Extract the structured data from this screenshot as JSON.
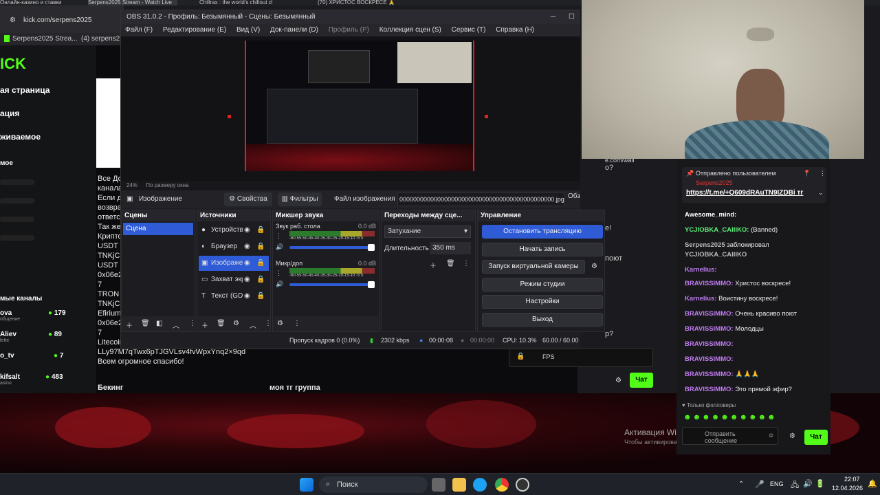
{
  "browser": {
    "tabs": [
      "Онлайн-казино и ставки",
      "Serpens2025 Stream - Watch Live",
      "Chillrax : the world's chillout cl",
      "(70) ХРИСТОС ВОСКРЕСЕ 🙏"
    ],
    "url": "kick.com/serpens2025",
    "bookmarks": [
      "Serpens2025 Strea...",
      "(4) serpens2"
    ]
  },
  "kick": {
    "logo": "ICK",
    "nav": [
      "ая страница",
      "ация",
      "живаемое",
      "мое"
    ],
    "recommended_title": "мые каналы",
    "channels": [
      {
        "name": "ova",
        "sub": "общение",
        "viewers": "179"
      },
      {
        "name": "Aliev",
        "sub": "lette",
        "viewers": "89"
      },
      {
        "name": "o_tv",
        "sub": "",
        "viewers": "7"
      },
      {
        "name": "kifsalt",
        "sub": "asino",
        "viewers": "483"
      }
    ],
    "desc_lines": [
      "Все До",
      "канала",
      "Если д",
      "возвра",
      "ответст",
      "Так же",
      "Крипто",
      "USDT T",
      "TNKjC2",
      "USDT E",
      "0x06e2",
      "7",
      "TRON T",
      "TNKjC2",
      "Efirium",
      "0x06e2",
      "7",
      "Litecoin адрес -",
      "LLy97M7qTwx6pTJGVLsv4fvWpxYnq2×9qd",
      "Всем огромное спасибо!"
    ],
    "bottom_left": "Бекинг",
    "bottom_mid": "моя тг группа",
    "right_fragments": [
      "o?",
      "e.com/wall",
      "e!",
      "поют",
      "p?"
    ],
    "chat_button": "Чат"
  },
  "obs": {
    "title": "OBS 31.0.2 - Профиль: Безымянный - Сцены: Безымянный",
    "menu": [
      "Файл (F)",
      "Редактирование (E)",
      "Вид (V)",
      "Док-панели (D)",
      "Профиль (P)",
      "Коллекция сцен (S)",
      "Сервис (T)",
      "Справка (H)"
    ],
    "zoom": "24%",
    "zoom_mode": "По размеру окна",
    "source_name": "Изображение",
    "properties": "Свойства",
    "filters": "Фильтры",
    "image_file_label": "Файл изображения",
    "image_file_value": "000000000000000000000000000000000000000000000.jpg",
    "browse": "Обзор",
    "docks": {
      "scenes": "Сцены",
      "sources": "Источники",
      "mixer": "Микшер звука",
      "transitions": "Переходы между сце...",
      "controls": "Управление"
    },
    "scenes": [
      "Сцена"
    ],
    "sources": [
      "Устройств",
      "Браузер",
      "Изображе",
      "Захват экр",
      "Текст (GDI"
    ],
    "mixer": [
      {
        "name": "Звук раб. стола",
        "db": "0.0 dB"
      },
      {
        "name": "Микр/доп",
        "db": "0.0 dB"
      }
    ],
    "meter_scale": "-60-55-50-45-40-35-30-25-20-15-10 -5 0",
    "transition": "Затухание",
    "duration_label": "Длительность",
    "duration_value": "350 ms",
    "controls": [
      "Остановить трансляцию",
      "Начать запись",
      "Запуск виртуальной камеры",
      "Режим студии",
      "Настройки",
      "Выход"
    ],
    "status": {
      "dropped": "Пропуск кадров 0 (0.0%)",
      "bitrate": "2302 kbps",
      "stream_time": "00:00:08",
      "rec_time": "00:00:00",
      "cpu": "CPU: 10.3%",
      "fps": "60.00 / 60.00 FPS"
    }
  },
  "chat": {
    "pinned_label": "Отправлено пользователем",
    "pinned_user": "Serpens2025",
    "pinned_link": "https://t.me/+Q609dRAuTN9IZDBi тг",
    "messages": [
      {
        "user": "Awesome_mind:",
        "text": "",
        "color": "#ffffff"
      },
      {
        "user": "YCJIOBKA_CAIIIKO:",
        "text": "(Banned)",
        "color": "#5ef07a"
      },
      {
        "user": "Serpens2025",
        "text": "заблокировал",
        "color": "#bbbbbb"
      },
      {
        "user": "YCJIOBKA_CAIIIKO",
        "text": "",
        "color": "#bbbbbb"
      },
      {
        "user": "Karnelius:",
        "text": "",
        "color": "#c07cf0"
      },
      {
        "user": "BRAVISSIMMO:",
        "text": "Христос воскресе!",
        "color": "#c07cf0"
      },
      {
        "user": "Karnelius:",
        "text": "Воистину воскресе!",
        "color": "#c07cf0"
      },
      {
        "user": "BRAVISSIMMO:",
        "text": "Очень красиво поют",
        "color": "#c07cf0"
      },
      {
        "user": "BRAVISSIMMO:",
        "text": "Молодцы",
        "color": "#c07cf0"
      },
      {
        "user": "BRAVISSIMMO:",
        "text": "",
        "color": "#c07cf0"
      },
      {
        "user": "BRAVISSIMMO:",
        "text": "",
        "color": "#c07cf0"
      },
      {
        "user": "BRAVISSIMMO:",
        "text": "🙏🙏🙏",
        "color": "#c07cf0"
      },
      {
        "user": "BRAVISSIMMO:",
        "text": "Это прямой эфир?",
        "color": "#c07cf0"
      }
    ],
    "followers_only": "Только фолловеры",
    "input_placeholder": "Отправить сообщение",
    "send": "Чат"
  },
  "windows": {
    "activation_title": "Активация Windows",
    "activation_text": "Чтобы активировать Windows, перейдите в раздел \"Параметры\".",
    "search": "Поиск",
    "lang": "ENG",
    "time": "22:07",
    "date": "12.04.2026"
  },
  "colors": {
    "accent_green": "#53fc18",
    "obs_blue": "#2f5bd6",
    "rec_red": "#d22222"
  }
}
